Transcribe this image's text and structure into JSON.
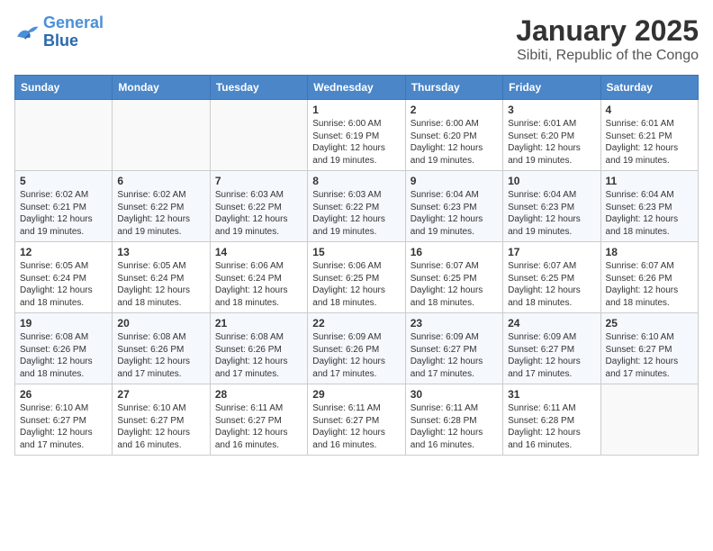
{
  "logo": {
    "line1": "General",
    "line2": "Blue"
  },
  "title": "January 2025",
  "subtitle": "Sibiti, Republic of the Congo",
  "days_of_week": [
    "Sunday",
    "Monday",
    "Tuesday",
    "Wednesday",
    "Thursday",
    "Friday",
    "Saturday"
  ],
  "weeks": [
    [
      {
        "day": "",
        "info": ""
      },
      {
        "day": "",
        "info": ""
      },
      {
        "day": "",
        "info": ""
      },
      {
        "day": "1",
        "info": "Sunrise: 6:00 AM\nSunset: 6:19 PM\nDaylight: 12 hours\nand 19 minutes."
      },
      {
        "day": "2",
        "info": "Sunrise: 6:00 AM\nSunset: 6:20 PM\nDaylight: 12 hours\nand 19 minutes."
      },
      {
        "day": "3",
        "info": "Sunrise: 6:01 AM\nSunset: 6:20 PM\nDaylight: 12 hours\nand 19 minutes."
      },
      {
        "day": "4",
        "info": "Sunrise: 6:01 AM\nSunset: 6:21 PM\nDaylight: 12 hours\nand 19 minutes."
      }
    ],
    [
      {
        "day": "5",
        "info": "Sunrise: 6:02 AM\nSunset: 6:21 PM\nDaylight: 12 hours\nand 19 minutes."
      },
      {
        "day": "6",
        "info": "Sunrise: 6:02 AM\nSunset: 6:22 PM\nDaylight: 12 hours\nand 19 minutes."
      },
      {
        "day": "7",
        "info": "Sunrise: 6:03 AM\nSunset: 6:22 PM\nDaylight: 12 hours\nand 19 minutes."
      },
      {
        "day": "8",
        "info": "Sunrise: 6:03 AM\nSunset: 6:22 PM\nDaylight: 12 hours\nand 19 minutes."
      },
      {
        "day": "9",
        "info": "Sunrise: 6:04 AM\nSunset: 6:23 PM\nDaylight: 12 hours\nand 19 minutes."
      },
      {
        "day": "10",
        "info": "Sunrise: 6:04 AM\nSunset: 6:23 PM\nDaylight: 12 hours\nand 19 minutes."
      },
      {
        "day": "11",
        "info": "Sunrise: 6:04 AM\nSunset: 6:23 PM\nDaylight: 12 hours\nand 18 minutes."
      }
    ],
    [
      {
        "day": "12",
        "info": "Sunrise: 6:05 AM\nSunset: 6:24 PM\nDaylight: 12 hours\nand 18 minutes."
      },
      {
        "day": "13",
        "info": "Sunrise: 6:05 AM\nSunset: 6:24 PM\nDaylight: 12 hours\nand 18 minutes."
      },
      {
        "day": "14",
        "info": "Sunrise: 6:06 AM\nSunset: 6:24 PM\nDaylight: 12 hours\nand 18 minutes."
      },
      {
        "day": "15",
        "info": "Sunrise: 6:06 AM\nSunset: 6:25 PM\nDaylight: 12 hours\nand 18 minutes."
      },
      {
        "day": "16",
        "info": "Sunrise: 6:07 AM\nSunset: 6:25 PM\nDaylight: 12 hours\nand 18 minutes."
      },
      {
        "day": "17",
        "info": "Sunrise: 6:07 AM\nSunset: 6:25 PM\nDaylight: 12 hours\nand 18 minutes."
      },
      {
        "day": "18",
        "info": "Sunrise: 6:07 AM\nSunset: 6:26 PM\nDaylight: 12 hours\nand 18 minutes."
      }
    ],
    [
      {
        "day": "19",
        "info": "Sunrise: 6:08 AM\nSunset: 6:26 PM\nDaylight: 12 hours\nand 18 minutes."
      },
      {
        "day": "20",
        "info": "Sunrise: 6:08 AM\nSunset: 6:26 PM\nDaylight: 12 hours\nand 17 minutes."
      },
      {
        "day": "21",
        "info": "Sunrise: 6:08 AM\nSunset: 6:26 PM\nDaylight: 12 hours\nand 17 minutes."
      },
      {
        "day": "22",
        "info": "Sunrise: 6:09 AM\nSunset: 6:26 PM\nDaylight: 12 hours\nand 17 minutes."
      },
      {
        "day": "23",
        "info": "Sunrise: 6:09 AM\nSunset: 6:27 PM\nDaylight: 12 hours\nand 17 minutes."
      },
      {
        "day": "24",
        "info": "Sunrise: 6:09 AM\nSunset: 6:27 PM\nDaylight: 12 hours\nand 17 minutes."
      },
      {
        "day": "25",
        "info": "Sunrise: 6:10 AM\nSunset: 6:27 PM\nDaylight: 12 hours\nand 17 minutes."
      }
    ],
    [
      {
        "day": "26",
        "info": "Sunrise: 6:10 AM\nSunset: 6:27 PM\nDaylight: 12 hours\nand 17 minutes."
      },
      {
        "day": "27",
        "info": "Sunrise: 6:10 AM\nSunset: 6:27 PM\nDaylight: 12 hours\nand 16 minutes."
      },
      {
        "day": "28",
        "info": "Sunrise: 6:11 AM\nSunset: 6:27 PM\nDaylight: 12 hours\nand 16 minutes."
      },
      {
        "day": "29",
        "info": "Sunrise: 6:11 AM\nSunset: 6:27 PM\nDaylight: 12 hours\nand 16 minutes."
      },
      {
        "day": "30",
        "info": "Sunrise: 6:11 AM\nSunset: 6:28 PM\nDaylight: 12 hours\nand 16 minutes."
      },
      {
        "day": "31",
        "info": "Sunrise: 6:11 AM\nSunset: 6:28 PM\nDaylight: 12 hours\nand 16 minutes."
      },
      {
        "day": "",
        "info": ""
      }
    ]
  ]
}
